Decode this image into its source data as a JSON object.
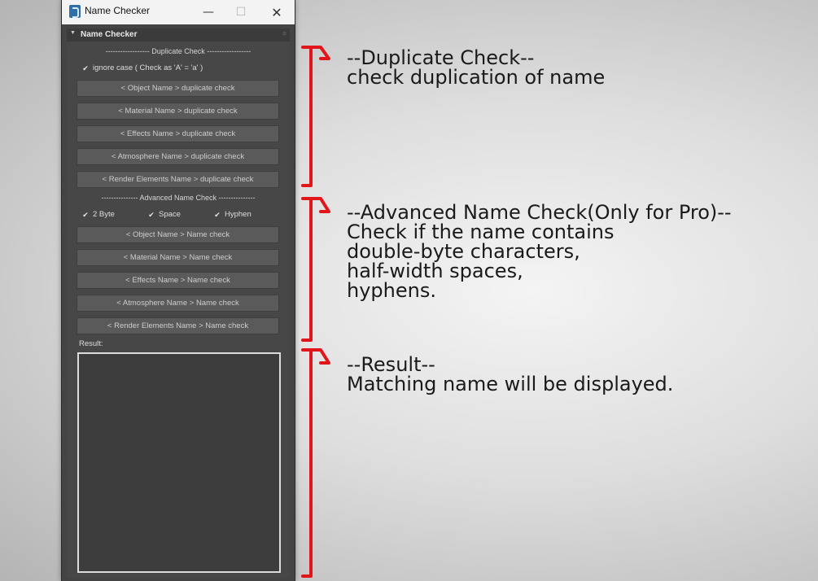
{
  "window": {
    "title": "Name Checker",
    "minimize_glyph": "—",
    "maximize_glyph": "☐",
    "close_glyph": "✕"
  },
  "rollout": {
    "header": "Name Checker",
    "collapse_glyph": "▼",
    "grip_glyph": "≡"
  },
  "duplicate": {
    "separator": "------------------ Duplicate Check ------------------",
    "ignore_case_label": "ignore case ( Check as 'A' = 'a' )",
    "ignore_case_checked": true,
    "buttons": [
      "< Object Name > duplicate check",
      "< Material Name > duplicate check",
      "< Effects Name > duplicate check",
      "< Atmosphere Name > duplicate check",
      "< Render Elements Name > duplicate check"
    ]
  },
  "advanced": {
    "separator": "--------------- Advanced Name Check ---------------",
    "options": [
      {
        "label": "2 Byte",
        "checked": true
      },
      {
        "label": "Space",
        "checked": true
      },
      {
        "label": "Hyphen",
        "checked": true
      }
    ],
    "buttons": [
      "< Object Name > Name check",
      "< Material Name > Name check",
      "< Effects Name > Name check",
      "< Atmosphere Name > Name check",
      "< Render Elements Name > Name check"
    ]
  },
  "result": {
    "label": "Result:",
    "text": ""
  },
  "annotations": {
    "bracket_color": "#e0161b",
    "duplicate": [
      "--Duplicate Check--",
      "check duplication of name"
    ],
    "advanced": [
      "--Advanced Name Check(Only for Pro)--",
      "Check if the name contains",
      "double-byte characters,",
      "half-width spaces,",
      "hyphens."
    ],
    "result": [
      "--Result--",
      "Matching name will be displayed."
    ]
  }
}
